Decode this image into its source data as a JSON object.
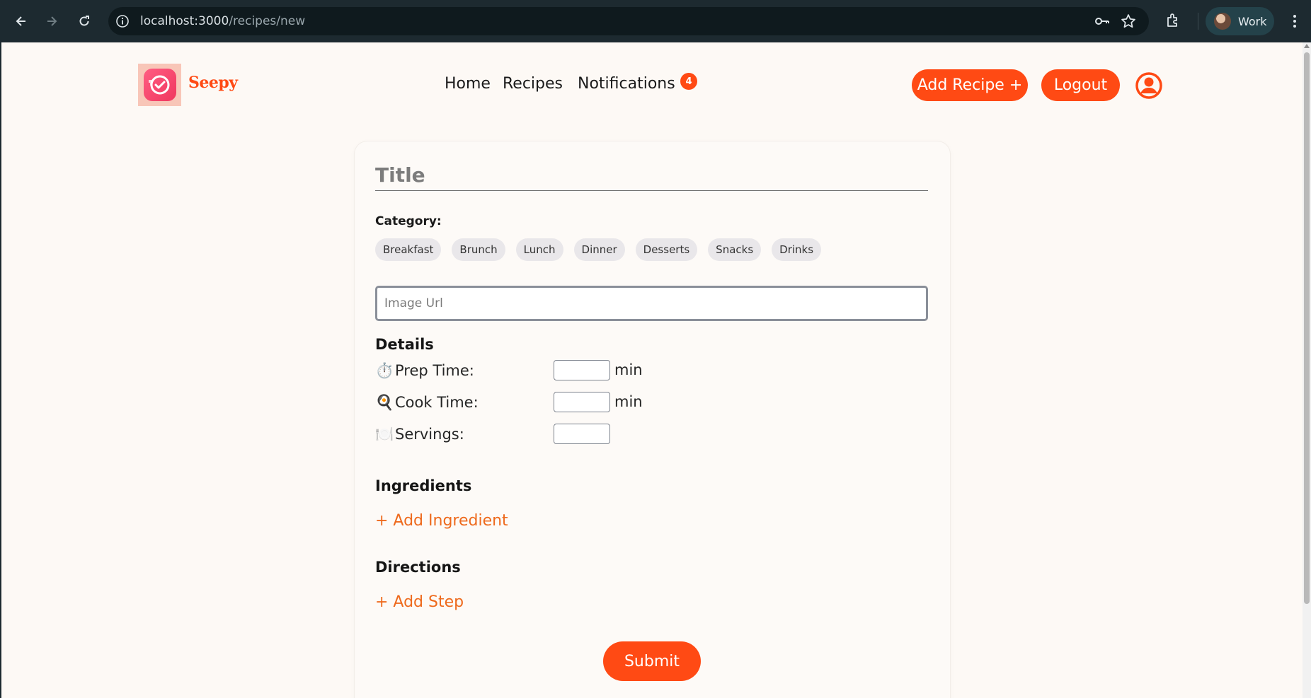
{
  "browser": {
    "url_host": "localhost:3000",
    "url_path": "/recipes/new",
    "profile_name": "Work"
  },
  "header": {
    "brand": "Seepy",
    "nav": [
      {
        "label": "Home"
      },
      {
        "label": "Recipes"
      },
      {
        "label": "Notifications",
        "badge": "4"
      }
    ],
    "add_recipe_label": "Add Recipe +",
    "logout_label": "Logout"
  },
  "form": {
    "title_placeholder": "Title",
    "category_label": "Category:",
    "categories": [
      "Breakfast",
      "Brunch",
      "Lunch",
      "Dinner",
      "Desserts",
      "Snacks",
      "Drinks"
    ],
    "image_url_placeholder": "Image Url",
    "details_heading": "Details",
    "details": [
      {
        "emoji": "⏱️",
        "label": "Prep Time:",
        "unit": "min"
      },
      {
        "emoji": "🍳",
        "label": "Cook Time:",
        "unit": "min"
      },
      {
        "emoji": "🍽️",
        "label": "Servings:",
        "unit": ""
      }
    ],
    "ingredients_heading": "Ingredients",
    "add_ingredient_label": "+ Add Ingredient",
    "directions_heading": "Directions",
    "add_step_label": "+ Add Step",
    "submit_label": "Submit"
  },
  "colors": {
    "accent": "#ff4a14",
    "link": "#ee6a1d",
    "page_bg": "#fdf9f5",
    "chrome_bg": "#1d2a30"
  }
}
